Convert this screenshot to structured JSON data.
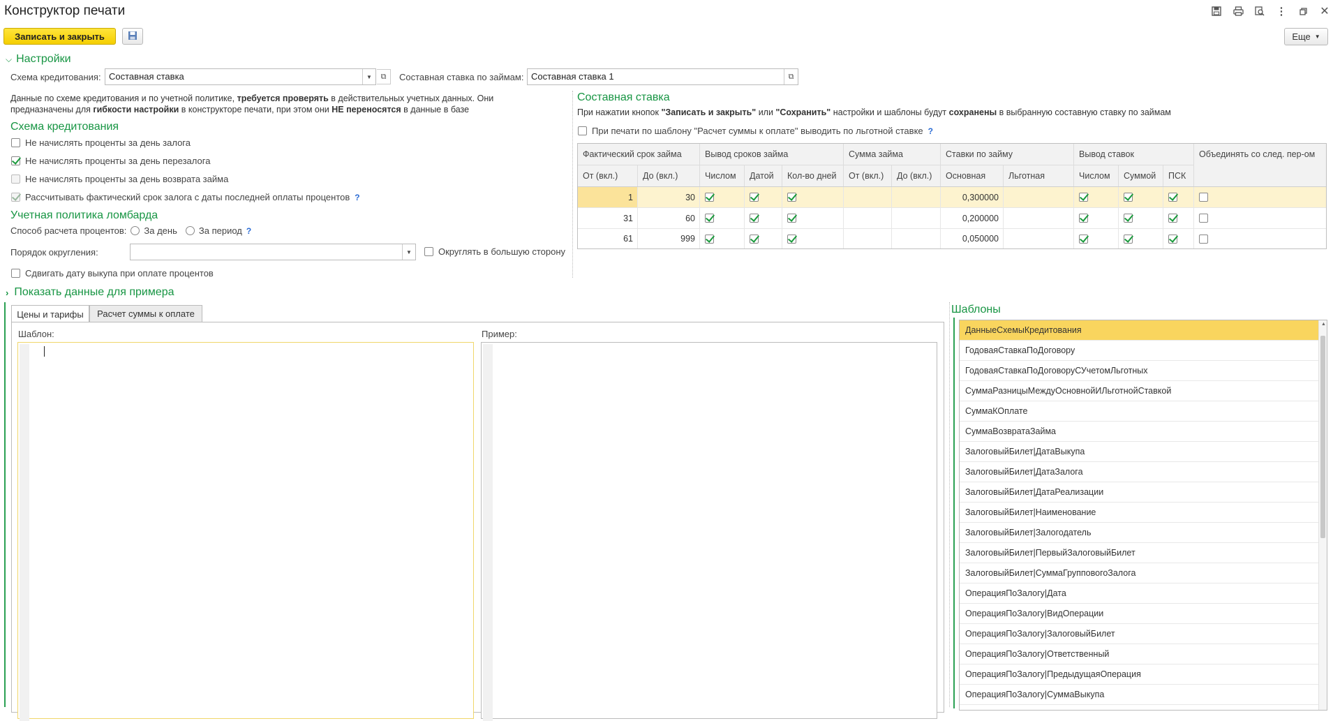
{
  "window": {
    "title": "Конструктор печати",
    "icons": [
      "save-icon",
      "print-icon",
      "preview-icon",
      "more-vert-icon",
      "restore-icon",
      "close-icon"
    ]
  },
  "toolbar": {
    "save_close_label": "Записать и закрыть",
    "more_label": "Еще"
  },
  "settings": {
    "header": "Настройки",
    "credit_scheme_label": "Схема кредитования:",
    "credit_scheme_value": "Составная ставка",
    "composite_rate_label": "Составная ставка по займам:",
    "composite_rate_value": "Составная ставка 1",
    "info_1": "Данные по схеме кредитования и по учетной политике,",
    "info_2": "требуется проверять",
    "info_3": "в действительных учетных данных. Они",
    "info_4": "предназначены для",
    "info_5": "гибкости настройки",
    "info_6": "в конструкторе печати, при этом они",
    "info_7": "НЕ переносятся",
    "info_8": "в данные в базе",
    "scheme_header": "Схема кредитования",
    "cb1": "Не начислять проценты за день залога",
    "cb2": "Не начислять проценты за день перезалога",
    "cb3": "Не начислять проценты за день возврата займа",
    "cb4": "Рассчитывать фактический срок залога с даты последней оплаты процентов",
    "policy_header": "Учетная политика ломбарда",
    "calc_method_label": "Способ расчета процентов:",
    "radio_day": "За день",
    "radio_period": "За период",
    "rounding_label": "Порядок округления:",
    "rounding_value": "",
    "round_up_label": "Округлять в большую сторону",
    "shift_date_label": "Сдвигать дату выкупа при оплате процентов",
    "help": "?"
  },
  "composite": {
    "header": "Составная ставка",
    "info_1": "При нажатии кнопок",
    "info_2": "\"Записать и закрыть\"",
    "info_3": "или",
    "info_4": "\"Сохранить\"",
    "info_5": "настройки и шаблоны будут",
    "info_6": "сохранены",
    "info_7": "в выбранную составную ставку по займам",
    "preferential_label": "При печати по шаблону \"Расчет суммы к оплате\" выводить по льготной ставке",
    "table": {
      "group_headers": [
        "Фактический срок займа",
        "Вывод сроков займа",
        "Сумма займа",
        "Ставки по займу",
        "Вывод ставок",
        "Объединять со след. пер-ом"
      ],
      "sub_headers": [
        "От (вкл.)",
        "До (вкл.)",
        "Числом",
        "Датой",
        "Кол-во дней",
        "От (вкл.)",
        "До (вкл.)",
        "Основная",
        "Льготная",
        "Числом",
        "Суммой",
        "ПСК"
      ],
      "rows": [
        {
          "from": "1",
          "to": "30",
          "rate": "0,300000"
        },
        {
          "from": "31",
          "to": "60",
          "rate": "0,200000"
        },
        {
          "from": "61",
          "to": "999",
          "rate": "0,050000"
        }
      ]
    }
  },
  "example": {
    "header": "Показать данные для примера"
  },
  "tabs": [
    "Цены и тарифы",
    "Расчет суммы к оплате"
  ],
  "editor": {
    "template_label": "Шаблон:",
    "example_label": "Пример:"
  },
  "templates": {
    "header": "Шаблоны",
    "items": [
      "ДанныеСхемыКредитования",
      "ГодоваяСтавкаПоДоговору",
      "ГодоваяСтавкаПоДоговоруСУчетомЛьготных",
      "СуммаРазницыМеждуОсновнойИЛьготнойСтавкой",
      "СуммаКОплате",
      "СуммаВозвратаЗайма",
      "ЗалоговыйБилет|ДатаВыкупа",
      "ЗалоговыйБилет|ДатаЗалога",
      "ЗалоговыйБилет|ДатаРеализации",
      "ЗалоговыйБилет|Наименование",
      "ЗалоговыйБилет|Залогодатель",
      "ЗалоговыйБилет|ПервыйЗалоговыйБилет",
      "ЗалоговыйБилет|СуммаГрупповогоЗалога",
      "ОперацияПоЗалогу|Дата",
      "ОперацияПоЗалогу|ВидОперации",
      "ОперацияПоЗалогу|ЗалоговыйБилет",
      "ОперацияПоЗалогу|Ответственный",
      "ОперацияПоЗалогу|ПредыдущаяОперация",
      "ОперацияПоЗалогу|СуммаВыкупа"
    ]
  },
  "colors": {
    "accent_green": "#179543",
    "primary_button": "#f5cf00",
    "selection": "#f9d55e",
    "link_blue": "#2a6bd4"
  }
}
